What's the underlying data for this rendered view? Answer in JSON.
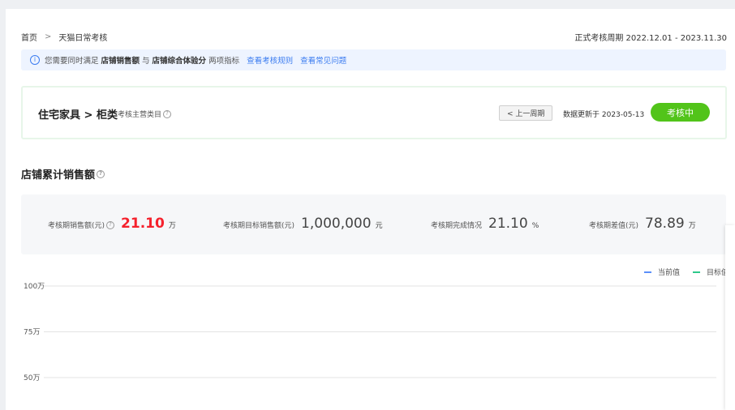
{
  "breadcrumb": {
    "home": "首页",
    "current": "天猫日常考核"
  },
  "period": {
    "label": "正式考核周期",
    "range": "2022.12.01 - 2023.11.30"
  },
  "notice": {
    "prefix": "您需要同时满足",
    "metric1": "店铺销售额",
    "and": "与",
    "metric2": "店铺综合体验分",
    "suffix": "两项指标",
    "link1": "查看考核规则",
    "link2": "查看常见问题"
  },
  "category": {
    "title": "住宅家具 > 柜类",
    "subtitle": "考核主营类目",
    "prev_button": "< 上一周期",
    "updated": "数据更新于 2023-05-13",
    "status_button": "考核中"
  },
  "section": {
    "title": "店铺累计销售额"
  },
  "stats": [
    {
      "label": "考核期销售额(元)",
      "value": "21.10",
      "unit": "万"
    },
    {
      "label": "考核期目标销售额(元)",
      "value": "1,000,000",
      "unit": "元"
    },
    {
      "label": "考核期完成情况",
      "value": "21.10",
      "unit": "%"
    },
    {
      "label": "考核期差值(元)",
      "value": "78.89",
      "unit": "万"
    }
  ],
  "colors": {
    "accent_green": "#52c41a",
    "target_line": "#2ec98a",
    "current_line": "#5b8ff9",
    "highlight_red": "#f5222d",
    "link_blue": "#3b7cf0"
  },
  "chart_data": {
    "type": "line",
    "legend": [
      "当前值",
      "目标值"
    ],
    "y_ticks": [
      "100万",
      "75万",
      "50万"
    ],
    "y_tick_values": [
      1000000,
      750000,
      500000
    ],
    "series": [
      {
        "name": "当前值",
        "values": []
      },
      {
        "name": "目标值",
        "value": 1000000
      }
    ],
    "grid": true,
    "legend_position": "top-right"
  }
}
